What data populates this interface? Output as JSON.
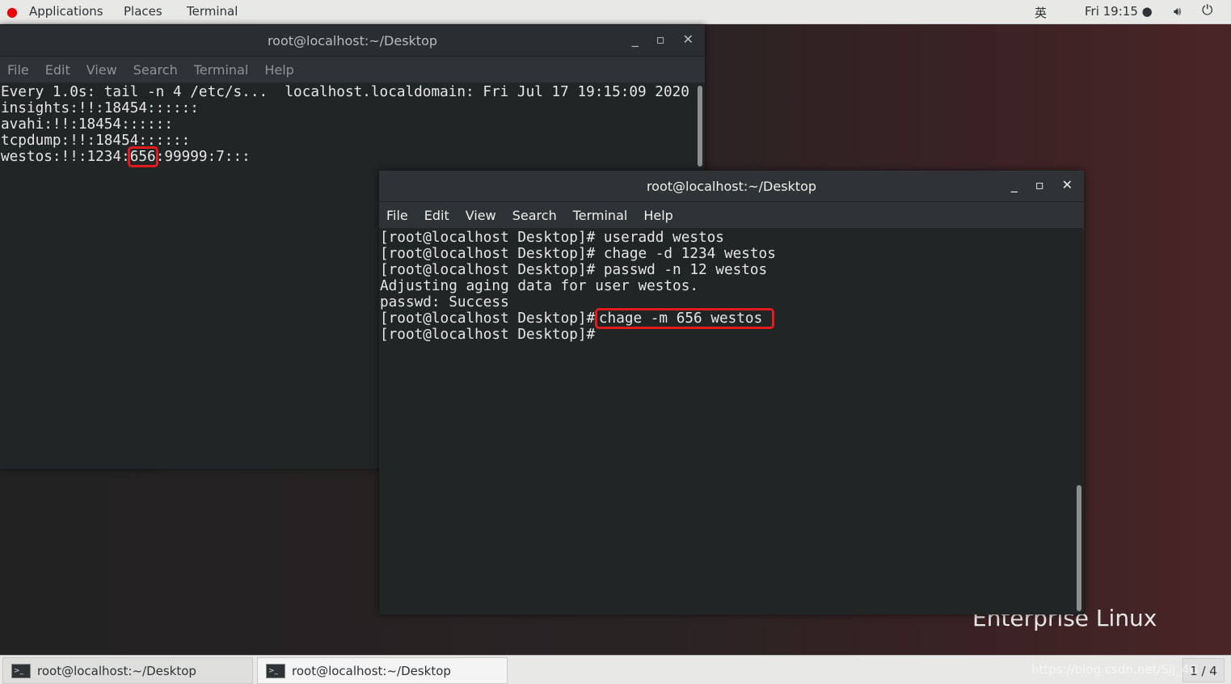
{
  "topbar": {
    "applications": "Applications",
    "places": "Places",
    "terminal": "Terminal",
    "input_method": "英",
    "clock": "Fri 19:15 ●"
  },
  "back_window": {
    "title": "root@localhost:~/Desktop",
    "menu": [
      "File",
      "Edit",
      "View",
      "Search",
      "Terminal",
      "Help"
    ],
    "lines": [
      "Every 1.0s: tail -n 4 /etc/s...  localhost.localdomain: Fri Jul 17 19:15:09 2020",
      "",
      "insights:!!:18454::::::",
      "avahi:!!:18454::::::",
      "tcpdump:!!:18454::::::"
    ],
    "last_line": {
      "before": "westos:!!:1234:",
      "highlight": "656",
      "after": ":99999:7:::"
    }
  },
  "front_window": {
    "title": "root@localhost:~/Desktop",
    "menu": [
      "File",
      "Edit",
      "View",
      "Search",
      "Terminal",
      "Help"
    ],
    "lines": [
      "[root@localhost Desktop]# useradd westos",
      "[root@localhost Desktop]# chage -d 1234 westos",
      "[root@localhost Desktop]# passwd -n 12 westos",
      "Adjusting aging data for user westos.",
      "passwd: Success"
    ],
    "prompt": "[root@localhost Desktop]#",
    "highlight_cmd": "chage -m 656 westos",
    "last_prompt": "[root@localhost Desktop]#"
  },
  "desktop": {
    "logo": "Enterprise Linux"
  },
  "taskbar": {
    "items": [
      "root@localhost:~/Desktop",
      "root@localhost:~/Desktop"
    ],
    "watermark": "https://blog.csdn.net/Sjj_4G",
    "pager": "1 / 4"
  },
  "colors": {
    "highlight": "#e21c1c",
    "redhat": "#e00"
  }
}
